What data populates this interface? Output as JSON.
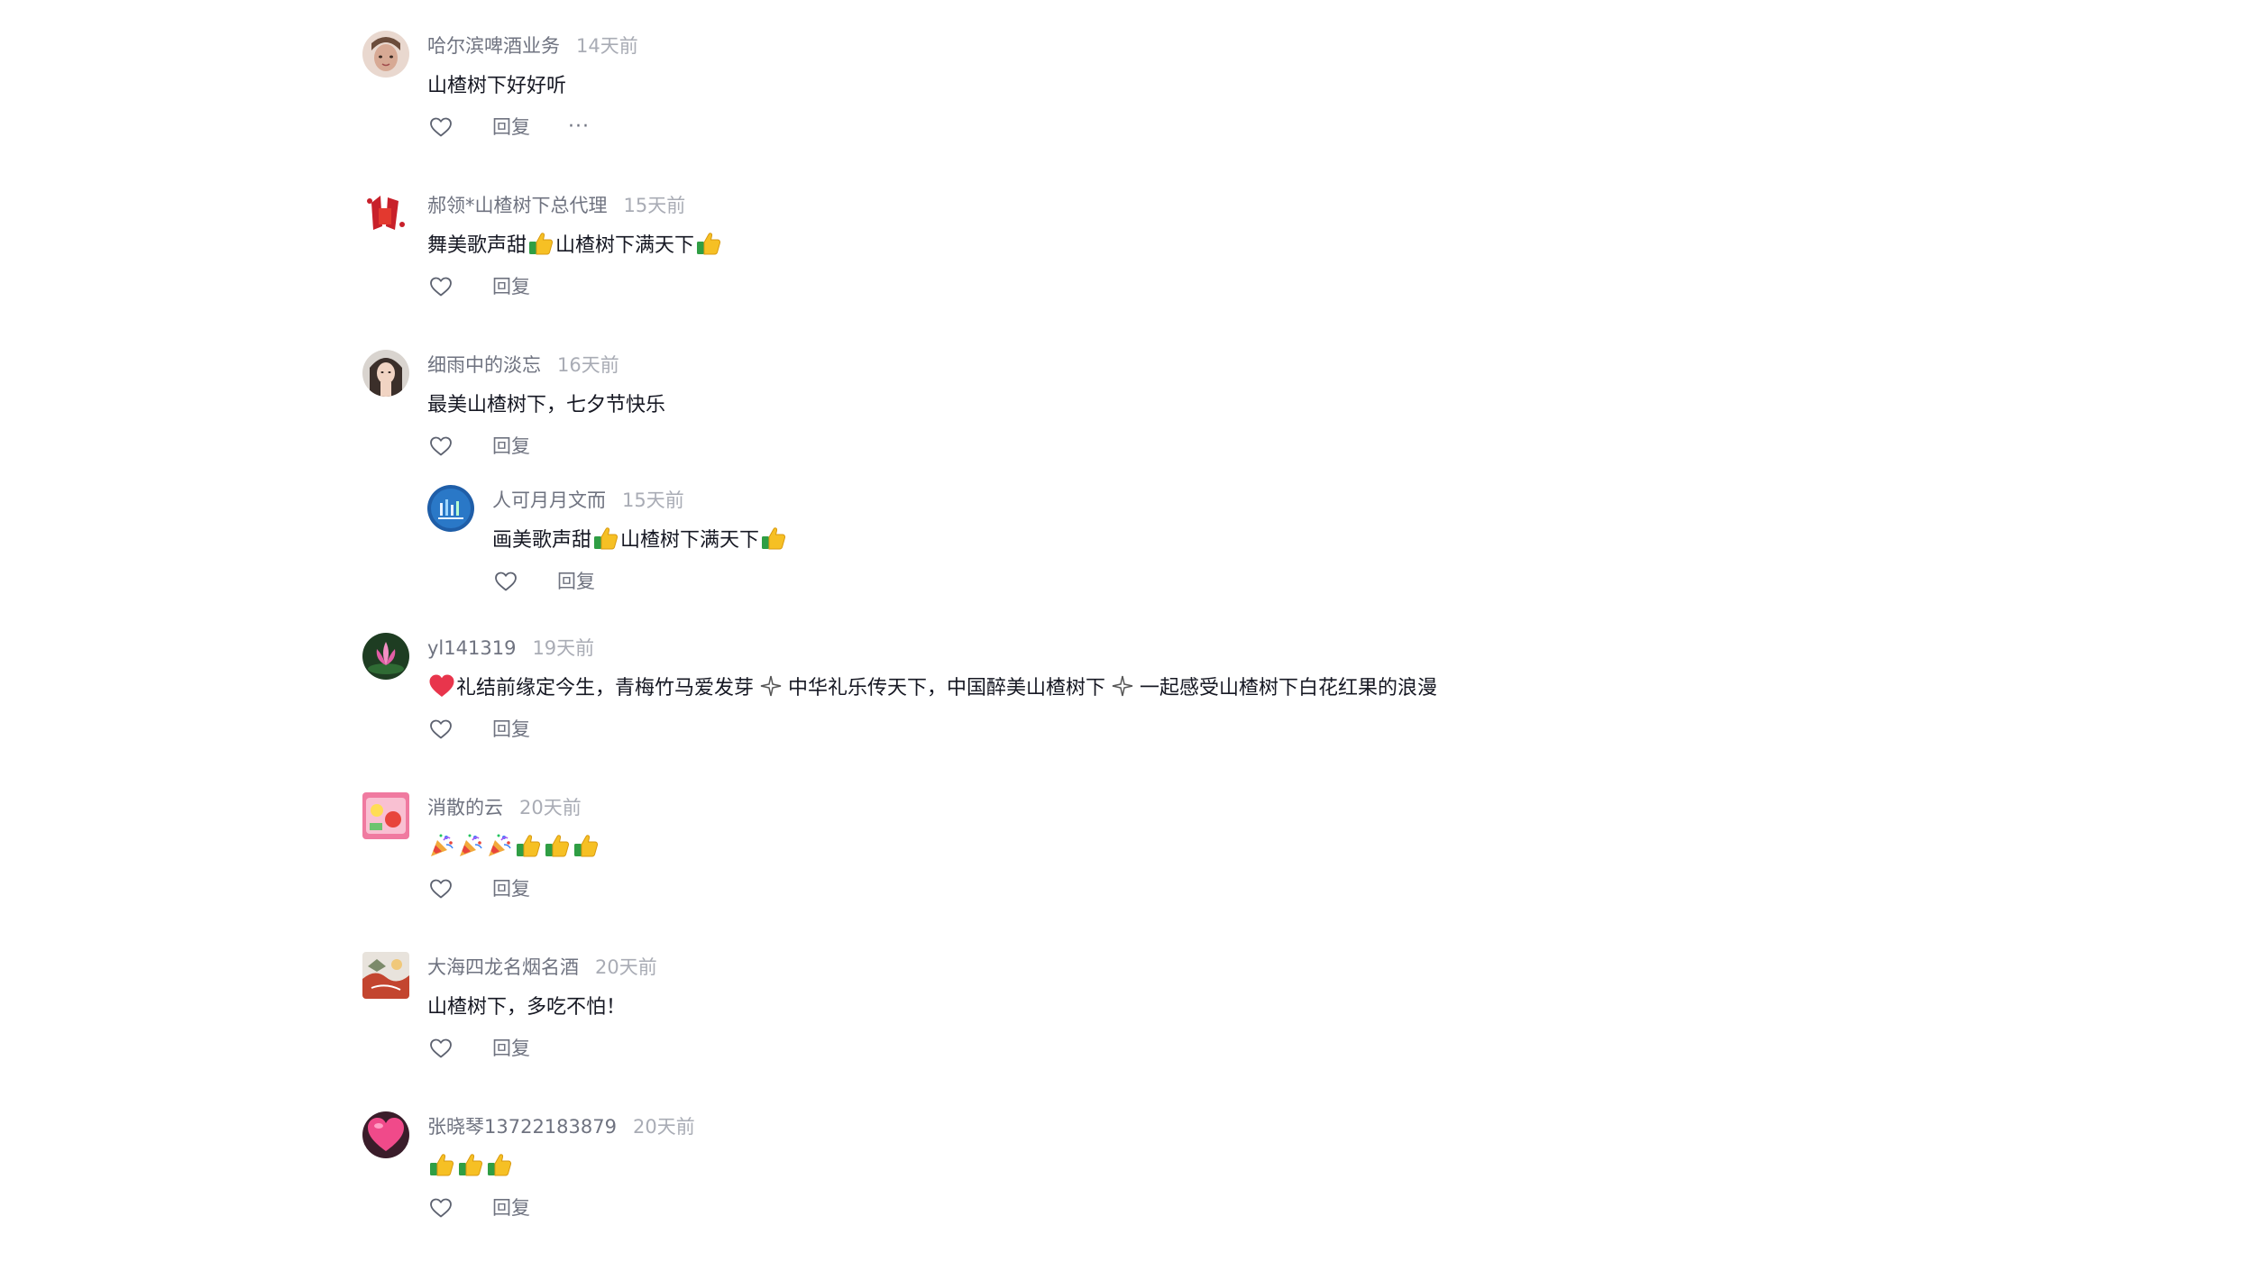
{
  "comments": [
    {
      "author": "哈尔滨啤酒业务",
      "time": "14天前",
      "text": "山楂树下好好听",
      "reply_label": "回复",
      "more_label": "···"
    },
    {
      "author": "郝领*山楂树下总代理",
      "time": "15天前",
      "text_part1": "舞美歌声甜",
      "text_part2": "山楂树下满天下",
      "reply_label": "回复"
    },
    {
      "author": "细雨中的淡忘",
      "time": "16天前",
      "text": "最美山楂树下，七夕节快乐",
      "reply_label": "回复",
      "reply": {
        "author": "人可月月文而",
        "time": "15天前",
        "text_part1": "画美歌声甜",
        "text_part2": "山楂树下满天下",
        "reply_label": "回复"
      }
    },
    {
      "author": "yl141319",
      "time": "19天前",
      "text_part1": "礼结前缘定今生，青梅竹马爱发芽",
      "text_part2": "中华礼乐传天下，中国醉美山楂树下",
      "text_part3": "一起感受山楂树下白花红果的浪漫",
      "reply_label": "回复"
    },
    {
      "author": "消散的云",
      "time": "20天前",
      "reply_label": "回复"
    },
    {
      "author": "大海四龙名烟名酒",
      "time": "20天前",
      "text": "山楂树下，多吃不怕！",
      "reply_label": "回复"
    },
    {
      "author": "张晓琴13722183879",
      "time": "20天前",
      "reply_label": "回复"
    }
  ],
  "icons": {
    "like": "heart-outline-icon",
    "thumbs_up": "thumbs-up-emoji",
    "party": "party-popper-emoji",
    "red_heart": "red-heart-emoji",
    "sparkle": "sparkle-icon",
    "accent_color": "#f2b01e"
  }
}
